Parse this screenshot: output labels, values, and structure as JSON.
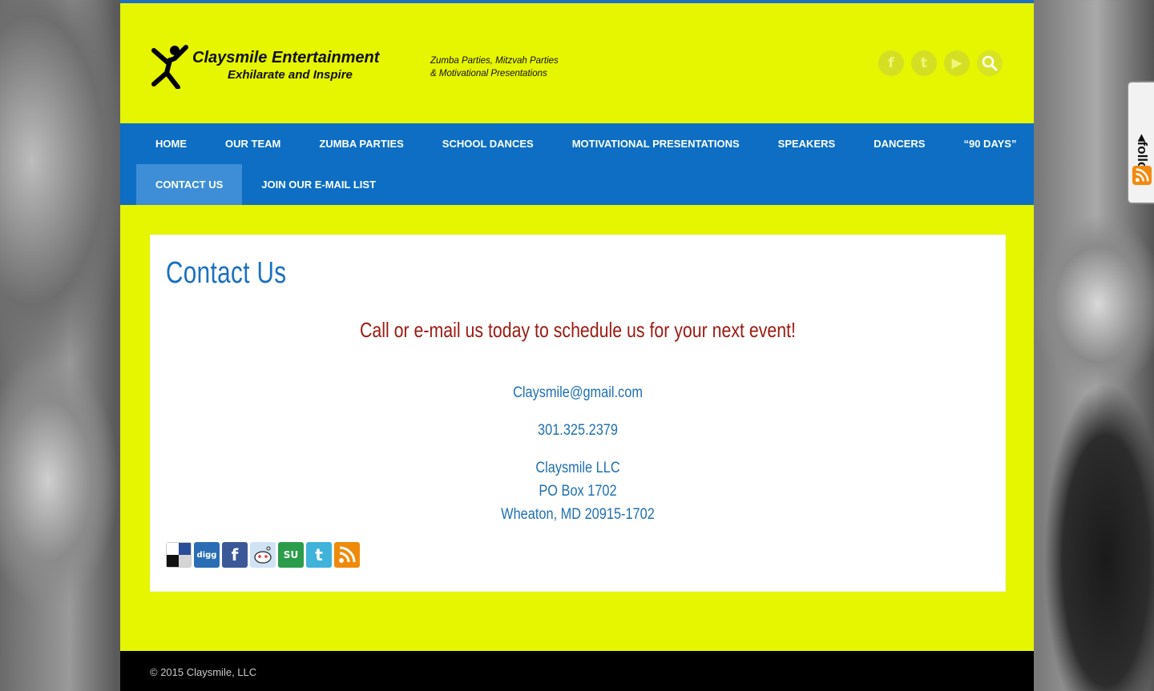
{
  "header": {
    "brand_name": "Claysmile Entertainment",
    "brand_tagline": "Exhilarate and Inspire",
    "brand_sub_line1": "Zumba Parties, Mitzvah Parties",
    "brand_sub_line2": "& Motivational Presentations",
    "social": [
      {
        "icon": "facebook-icon",
        "glyph": "f"
      },
      {
        "icon": "twitter-icon",
        "glyph": "t"
      },
      {
        "icon": "youtube-icon",
        "glyph": "▶"
      },
      {
        "icon": "search-icon",
        "glyph": "🔍"
      }
    ]
  },
  "nav": {
    "row1": [
      "HOME",
      "OUR TEAM",
      "ZUMBA PARTIES",
      "SCHOOL DANCES",
      "MOTIVATIONAL PRESENTATIONS",
      "SPEAKERS",
      "DANCERS",
      "“90 DAYS”"
    ],
    "row2": [
      "CONTACT US",
      "JOIN OUR E-MAIL LIST"
    ],
    "active": "CONTACT US"
  },
  "content": {
    "title": "Contact Us",
    "cta": "Call or e-mail us today to schedule us for your next event!",
    "email": "Claysmile@gmail.com",
    "phone": "301.325.2379",
    "address_line1": "Claysmile LLC",
    "address_line2": "PO Box 1702",
    "address_line3": "Wheaton, MD 20915-1702",
    "share_icons": [
      {
        "name": "delicious-icon",
        "color": "#ffffff"
      },
      {
        "name": "digg-icon",
        "label": "digg",
        "color": "#2a6db5"
      },
      {
        "name": "facebook-share-icon",
        "label": "f",
        "color": "#3b5998"
      },
      {
        "name": "reddit-icon",
        "color": "#cfe3f5"
      },
      {
        "name": "stumbleupon-icon",
        "label": "SU",
        "color": "#2a9d4a"
      },
      {
        "name": "twitter-share-icon",
        "label": "t",
        "color": "#3fb3d9"
      },
      {
        "name": "rss-share-icon",
        "color": "#f08a0a"
      }
    ]
  },
  "footer": {
    "copyright": "© 2015 Claysmile, LLC"
  },
  "follow_widget": {
    "label": "◂follow"
  },
  "colors": {
    "accent_yellow": "#e6f500",
    "nav_blue": "#0d6ec4",
    "title_blue": "#1a70c2",
    "cta_red": "#9b1a12"
  }
}
